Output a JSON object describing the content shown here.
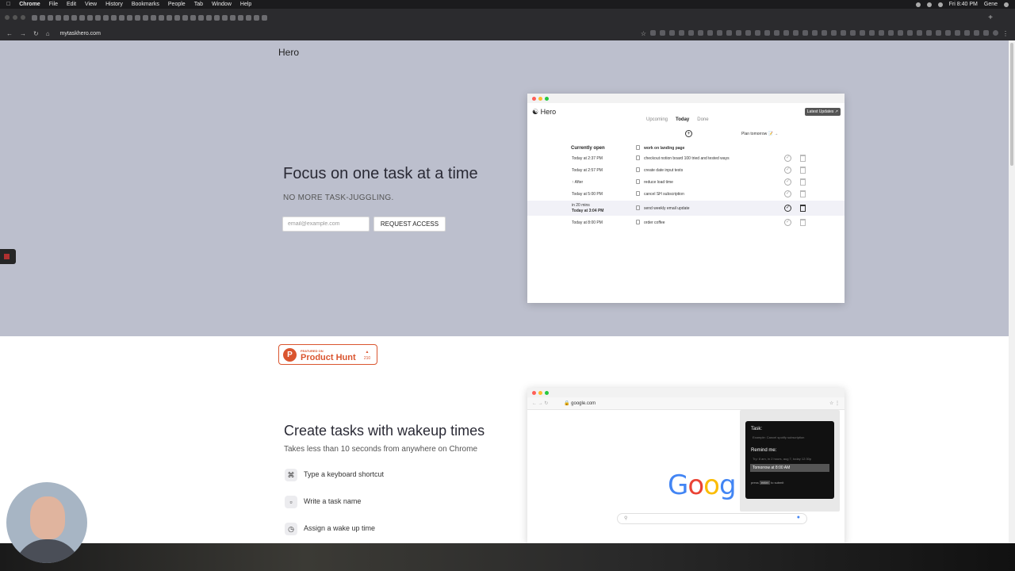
{
  "menubar": {
    "app": "Chrome",
    "items": [
      "File",
      "Edit",
      "View",
      "History",
      "Bookmarks",
      "People",
      "Tab",
      "Window",
      "Help"
    ],
    "clock": "Fri 8:40 PM",
    "user": "Gene"
  },
  "toolbar": {
    "url": "mytaskhero.com"
  },
  "hero": {
    "logo": "Hero",
    "headline": "Focus on one task at a time",
    "subhead": "NO MORE TASK-JUGGLING.",
    "email_placeholder": "email@example.com",
    "request_button": "REQUEST ACCESS"
  },
  "app_screenshot": {
    "title": "Hero",
    "latest_updates": "Latest Updates ↗",
    "tabs": [
      "Upcoming",
      "Today",
      "Done"
    ],
    "plan_tomorrow": "Plan tomorrow 📝 →",
    "currently_open_label": "Currently open",
    "rows": [
      {
        "time": "",
        "sub": "",
        "task": "work on landing page"
      },
      {
        "time": "Today at 2:37 PM",
        "sub": "",
        "task": "checkout notion board 100 tried and tested ways"
      },
      {
        "time": "Today at 2:57 PM",
        "sub": "",
        "task": "create date input tests"
      },
      {
        "time": "↑ After",
        "sub": "",
        "task": "reduce load time"
      },
      {
        "time": "Today at 5:00 PM",
        "sub": "",
        "task": "cancel SH subscription"
      },
      {
        "time": "in 20 mins",
        "sub": "Today at 3:04 PM",
        "task": "send weekly email update"
      },
      {
        "time": "Today at 8:00 PM",
        "sub": "",
        "task": "order coffee"
      }
    ]
  },
  "producthunt": {
    "featured": "FEATURED ON",
    "name": "Product Hunt",
    "count": "210"
  },
  "section2": {
    "headline": "Create tasks with wakeup times",
    "subhead": "Takes less than 10 seconds from anywhere on Chrome",
    "features": [
      {
        "icon": "command-icon",
        "text": "Type a keyboard shortcut"
      },
      {
        "icon": "clipboard-icon",
        "text": "Write a task name"
      },
      {
        "icon": "clock-icon",
        "text": "Assign a wake up time"
      }
    ]
  },
  "chrome_screenshot": {
    "url": "google.com",
    "popup": {
      "task_label": "Task:",
      "task_placeholder": "Example: Cancel spotify subscription",
      "remind_label": "Remind me:",
      "remind_placeholder": "Try: 8 am, in 2 hours, aug 7, today 12:30p",
      "remind_value": "Tomorrow at 8:00 AM",
      "press": "press",
      "key": "enter",
      "submit": "to submit"
    }
  }
}
